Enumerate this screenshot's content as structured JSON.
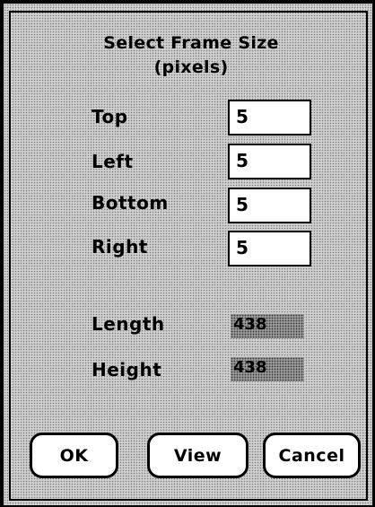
{
  "dialog": {
    "title_line1": "Select Frame Size",
    "title_line2": "(pixels)"
  },
  "fields": {
    "top": {
      "label": "Top",
      "value": "5"
    },
    "left": {
      "label": "Left",
      "value": "5"
    },
    "bottom": {
      "label": "Bottom",
      "value": "5"
    },
    "right": {
      "label": "Right",
      "value": "5"
    }
  },
  "readouts": {
    "length": {
      "label": "Length",
      "value": "438"
    },
    "height": {
      "label": "Height",
      "value": "438"
    }
  },
  "buttons": {
    "ok": "OK",
    "view": "View",
    "cancel": "Cancel"
  }
}
